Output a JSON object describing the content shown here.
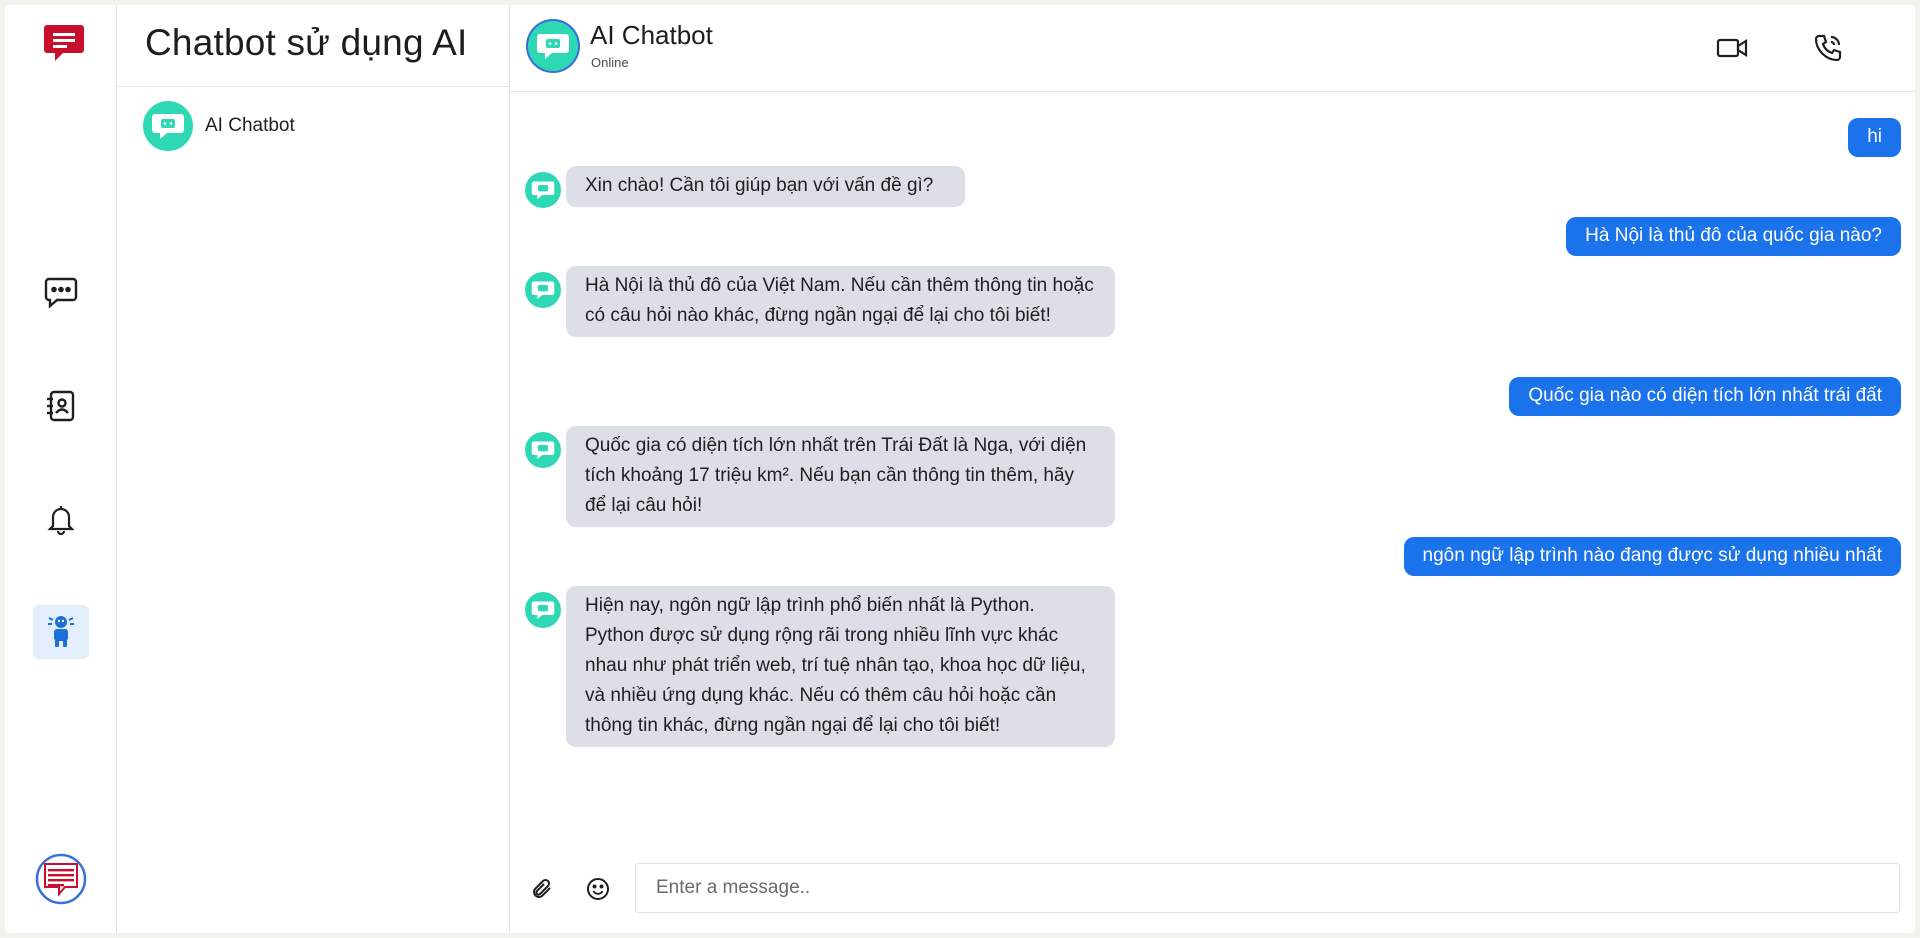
{
  "sidebar": {
    "logo_icon": "chat-logo-icon",
    "items": [
      {
        "icon": "chat-bubble-icon",
        "active": false
      },
      {
        "icon": "contacts-book-icon",
        "active": false
      },
      {
        "icon": "bell-icon",
        "active": false
      },
      {
        "icon": "robot-icon",
        "active": true
      }
    ],
    "profile_icon": "user-avatar-icon"
  },
  "conversation_list": {
    "title": "Chatbot sử dụng AI",
    "items": [
      {
        "name": "AI Chatbot",
        "avatar": "bot-avatar-icon"
      }
    ]
  },
  "chat": {
    "header": {
      "name": "AI Chatbot",
      "status": "Online",
      "actions": [
        "video-call-icon",
        "phone-call-icon"
      ]
    },
    "messages": [
      {
        "from": "user",
        "text": "hi"
      },
      {
        "from": "bot",
        "text": "Xin chào! Cần tôi giúp bạn với vấn đề gì?"
      },
      {
        "from": "user",
        "text": "Hà Nội là thủ đô của quốc gia nào?"
      },
      {
        "from": "bot",
        "text": "Hà Nội là thủ đô của Việt Nam. Nếu cần thêm thông tin hoặc có câu hỏi nào khác, đừng ngần ngại để lại cho tôi biết!"
      },
      {
        "from": "user",
        "text": "Quốc gia nào có diện tích lớn nhất trái đất"
      },
      {
        "from": "bot",
        "text": "Quốc gia có diện tích lớn nhất trên Trái Đất là Nga, với diện tích khoảng 17 triệu km². Nếu bạn cần thông tin thêm, hãy để lại câu hỏi!"
      },
      {
        "from": "user",
        "text": "ngôn ngữ lập trình nào đang được sử dụng nhiều nhất"
      },
      {
        "from": "bot",
        "text": "Hiện nay, ngôn ngữ lập trình phổ biến nhất là Python. Python được sử dụng rộng rãi trong nhiều lĩnh vực khác nhau như phát triển web, trí tuệ nhân tạo, khoa học dữ liệu, và nhiều ứng dụng khác. Nếu có thêm câu hỏi hoặc cần thông tin khác, đừng ngần ngại để lại cho tôi biết!"
      }
    ],
    "composer": {
      "placeholder": "Enter a message..",
      "attach_icon": "paperclip-icon",
      "emoji_icon": "emoji-icon"
    }
  },
  "colors": {
    "user_bubble": "#1a73ea",
    "bot_bubble": "#dcdee8",
    "bot_avatar": "#2ed8b4",
    "logo_red": "#c8102e",
    "active_nav": "#e3effc"
  }
}
